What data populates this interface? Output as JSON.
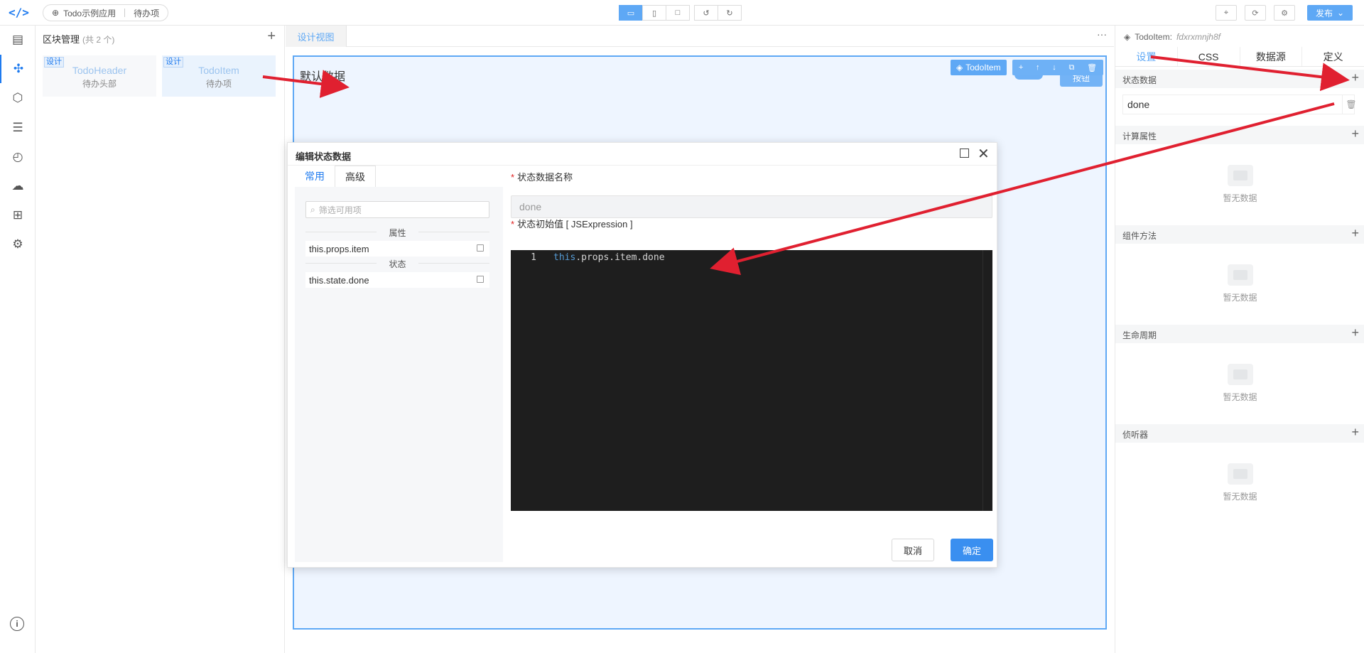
{
  "topbar": {
    "app_name": "Todo示例应用",
    "page_name": "待办项",
    "publish_label": "发布",
    "devices": [
      "desktop-icon",
      "phone-icon",
      "tablet-icon"
    ],
    "history": [
      "undo-icon",
      "redo-icon"
    ],
    "tools": [
      "inspect-icon",
      "refresh-icon",
      "gear-icon"
    ]
  },
  "rail": {
    "items": [
      "pages-icon",
      "puzzle-icon",
      "cube-icon",
      "outline-icon",
      "history-icon",
      "cloud-api-icon",
      "apps-icon",
      "gear-icon"
    ],
    "active_index": 1
  },
  "blocks": {
    "title": "区块管理",
    "count": "(共 2 个)",
    "items": [
      {
        "tag": "设计",
        "name": "TodoHeader",
        "desc": "待办头部"
      },
      {
        "tag": "设计",
        "name": "TodoItem",
        "desc": "待办项"
      }
    ]
  },
  "canvas": {
    "tab": "设计视图",
    "more": "···",
    "default_text": "默认数据",
    "component_label": "TodoItem",
    "button_text": "按钮"
  },
  "modal": {
    "title": "编辑状态数据",
    "tabs": [
      "常用",
      "高级"
    ],
    "search_placeholder": "筛选可用项",
    "props_section": "属性",
    "props": [
      "this.props.item"
    ],
    "state_section": "状态",
    "states": [
      "this.state.done"
    ],
    "name_label": "状态数据名称",
    "name_value": "done",
    "init_label": "状态初始值 [ JSExpression ]",
    "code_line_no": "1",
    "code_keyword": "this",
    "code_rest": ".props.item.done",
    "cancel": "取消",
    "ok": "确定"
  },
  "right_panel": {
    "component": "TodoItem:",
    "component_id": "fdxrxmnjh8f",
    "tabs": [
      "设置",
      "CSS",
      "数据源",
      "定义"
    ],
    "active_tab": 0,
    "sections": [
      {
        "title": "状态数据"
      },
      {
        "title": "计算属性"
      },
      {
        "title": "组件方法"
      },
      {
        "title": "生命周期"
      },
      {
        "title": "侦听器"
      }
    ],
    "state_item": "done",
    "empty_text": "暂无数据"
  },
  "colors": {
    "accent": "#1f7bef",
    "light_accent": "#5ea8f5",
    "arrow": "#e02030",
    "editor_bg": "#1e1e1e"
  }
}
